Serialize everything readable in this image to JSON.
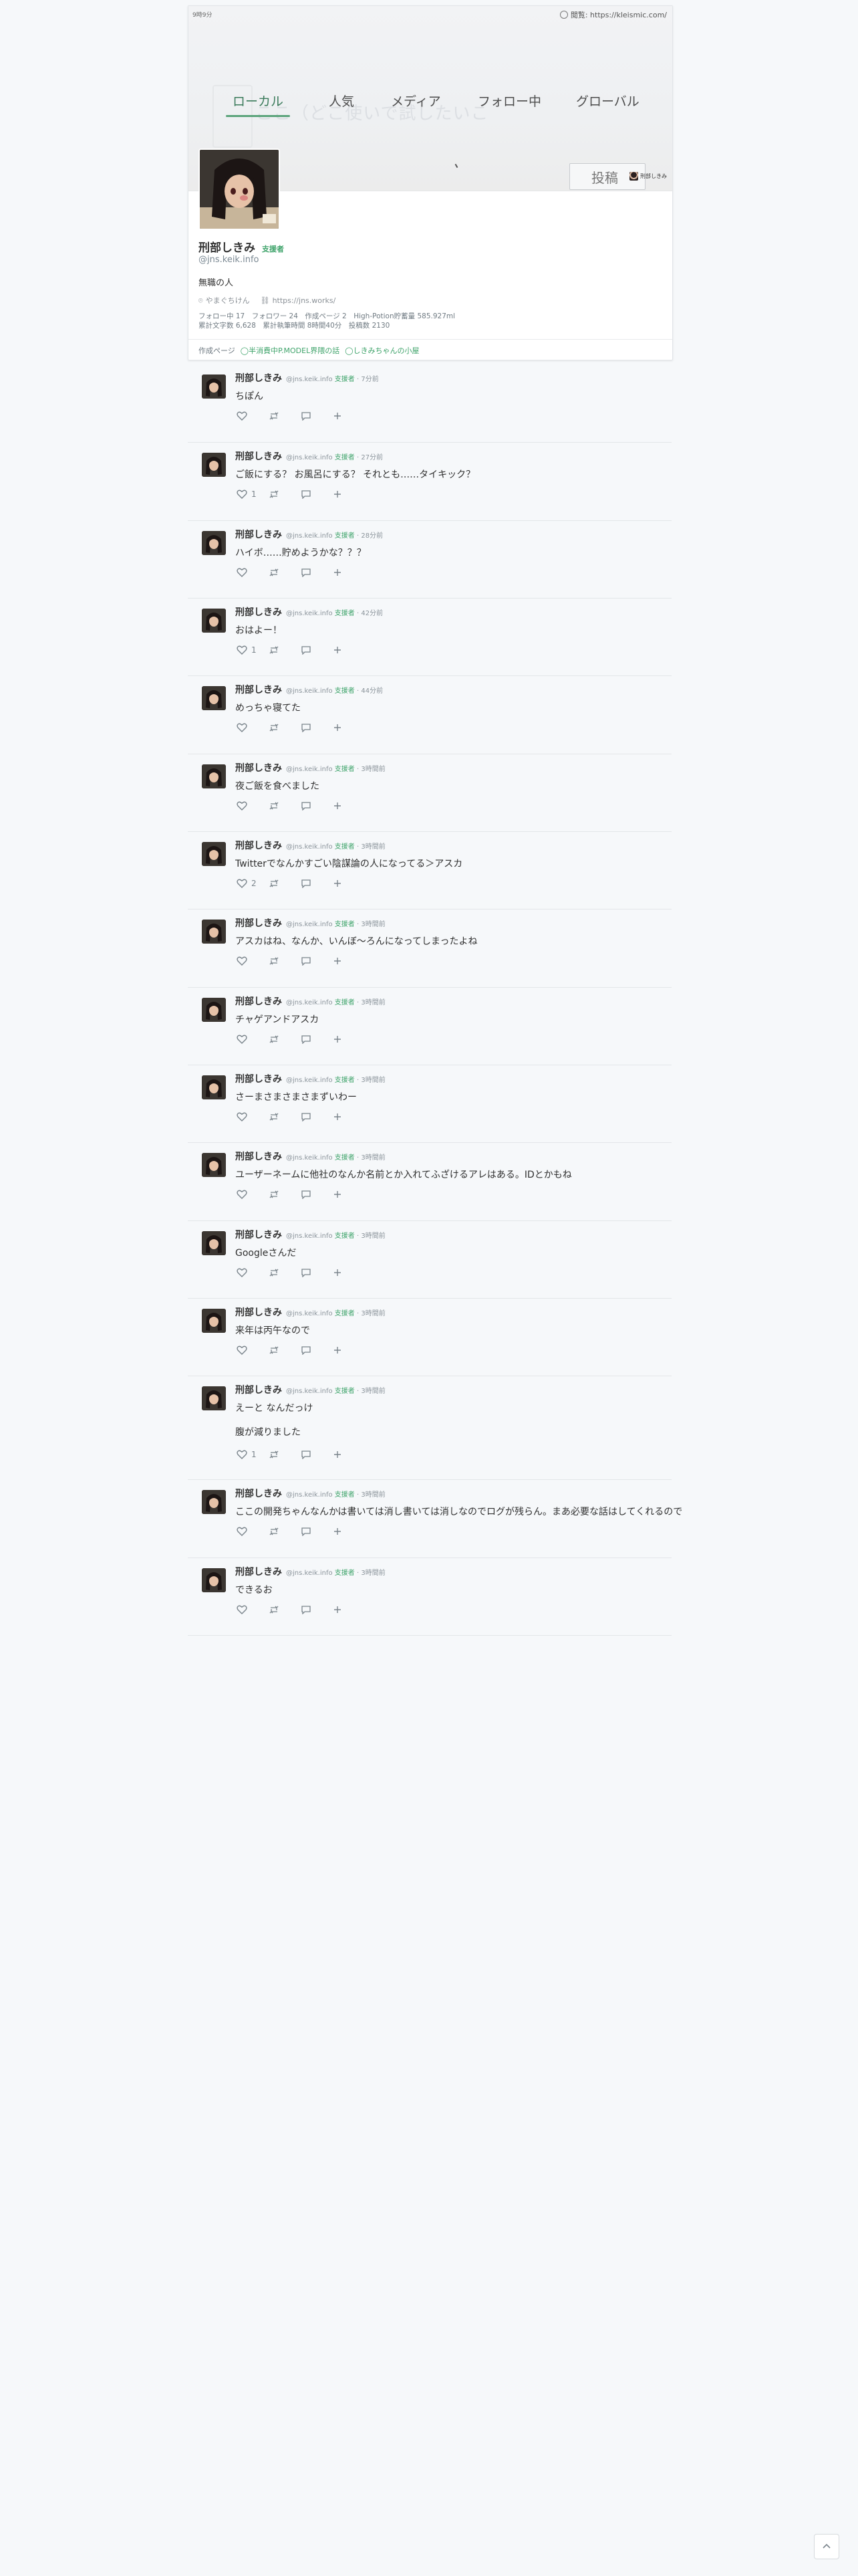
{
  "window": {
    "time": "9時9分",
    "url": "閲覧: https://kleismic.com/"
  },
  "tabs": [
    {
      "label": "ローカル",
      "active": true
    },
    {
      "label": "人気",
      "active": false
    },
    {
      "label": "メディア",
      "active": false
    },
    {
      "label": "フォロー中",
      "active": false
    },
    {
      "label": "グローバル",
      "active": false
    }
  ],
  "composer": {
    "post_label": "投稿",
    "user_label": "刑部しきみ"
  },
  "banner_text": "ここ（どこ使いで試したいこ",
  "profile": {
    "name": "刑部しきみ",
    "badge": "支援者",
    "handle": "@jns.keik.info",
    "bio": "無職の人",
    "location": "やまぐちけん",
    "website": "https://jns.works/",
    "stats_line1": "フォロー中 17　フォロワー 24　作成ページ 2　High-Potion貯蓄量 585.927ml",
    "stats_line2": "累計文字数 6,628　累計執筆時間 8時間40分　投稿数 2130",
    "pages_label": "作成ページ",
    "pages": [
      "◯半消費中P.MODEL界隈の話",
      "◯しきみちゃんの小屋"
    ]
  },
  "accent": "#3ea36a",
  "notes": [
    {
      "name": "刑部しきみ",
      "handle": "@jns.keik.info",
      "badge": "支援者",
      "time": "7分前",
      "text": "ちぽん",
      "text2": "",
      "likes": "",
      "height": 117
    },
    {
      "name": "刑部しきみ",
      "handle": "@jns.keik.info",
      "badge": "支援者",
      "time": "27分前",
      "text": "ご飯にする？ お風呂にする？ それとも……タイキック？",
      "text2": "",
      "likes": "1",
      "height": 117
    },
    {
      "name": "刑部しきみ",
      "handle": "@jns.keik.info",
      "badge": "支援者",
      "time": "28分前",
      "text": "ハイボ……貯めようかな？？？",
      "text2": "",
      "likes": "",
      "height": 116
    },
    {
      "name": "刑部しきみ",
      "handle": "@jns.keik.info",
      "badge": "支援者",
      "time": "42分前",
      "text": "おはよー！",
      "text2": "",
      "likes": "1",
      "height": 116
    },
    {
      "name": "刑部しきみ",
      "handle": "@jns.keik.info",
      "badge": "支援者",
      "time": "44分前",
      "text": "めっちゃ寝てた",
      "text2": "",
      "likes": "",
      "height": 117
    },
    {
      "name": "刑部しきみ",
      "handle": "@jns.keik.info",
      "badge": "支援者",
      "time": "3時間前",
      "text": "夜ご飯を食べました",
      "text2": "",
      "likes": "",
      "height": 116
    },
    {
      "name": "刑部しきみ",
      "handle": "@jns.keik.info",
      "badge": "支援者",
      "time": "3時間前",
      "text": "Twitterでなんかすごい陰謀論の人になってる＞アスカ",
      "text2": "",
      "likes": "2",
      "height": 116
    },
    {
      "name": "刑部しきみ",
      "handle": "@jns.keik.info",
      "badge": "支援者",
      "time": "3時間前",
      "text": "アスカはね、なんか、いんぼ〜ろんになってしまったよね",
      "text2": "",
      "likes": "",
      "height": 117
    },
    {
      "name": "刑部しきみ",
      "handle": "@jns.keik.info",
      "badge": "支援者",
      "time": "3時間前",
      "text": "チャゲアンドアスカ",
      "text2": "",
      "likes": "",
      "height": 116
    },
    {
      "name": "刑部しきみ",
      "handle": "@jns.keik.info",
      "badge": "支援者",
      "time": "3時間前",
      "text": "さーまさまさまさまずいわー",
      "text2": "",
      "likes": "",
      "height": 116
    },
    {
      "name": "刑部しきみ",
      "handle": "@jns.keik.info",
      "badge": "支援者",
      "time": "3時間前",
      "text": "ユーザーネームに他社のなんか名前とか入れてふざけるアレはある。IDとかもね",
      "text2": "",
      "likes": "",
      "height": 117
    },
    {
      "name": "刑部しきみ",
      "handle": "@jns.keik.info",
      "badge": "支援者",
      "time": "3時間前",
      "text": "Googleさんだ",
      "text2": "",
      "likes": "",
      "height": 116
    },
    {
      "name": "刑部しきみ",
      "handle": "@jns.keik.info",
      "badge": "支援者",
      "time": "3時間前",
      "text": "来年は丙午なので",
      "text2": "",
      "likes": "",
      "height": 116
    },
    {
      "name": "刑部しきみ",
      "handle": "@jns.keik.info",
      "badge": "支援者",
      "time": "3時間前",
      "text": "えーと なんだっけ",
      "text2": "腹が減りました",
      "likes": "1",
      "height": 155
    },
    {
      "name": "刑部しきみ",
      "handle": "@jns.keik.info",
      "badge": "支援者",
      "time": "3時間前",
      "text": "ここの開発ちゃんなんかは書いては消し書いては消しなのでログが残らん。まあ必要な話はしてくれるので",
      "text2": "",
      "likes": "",
      "height": 117
    },
    {
      "name": "刑部しきみ",
      "handle": "@jns.keik.info",
      "badge": "支援者",
      "time": "3時間前",
      "text": "できるお",
      "text2": "",
      "likes": "",
      "height": 116
    }
  ]
}
